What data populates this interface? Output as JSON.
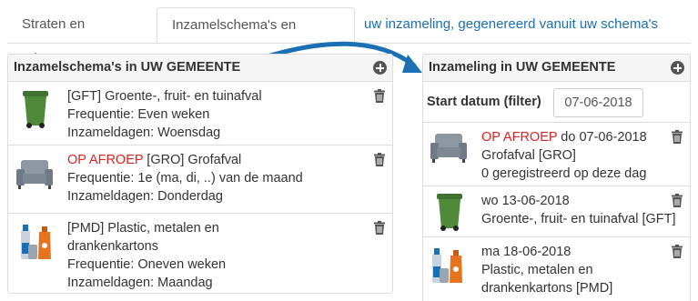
{
  "tabs": [
    {
      "label": "Straten en adressen"
    },
    {
      "label": "Inzamelschema's en datums"
    },
    {
      "label": "uw inzameling, gegenereerd vanuit uw schema's"
    }
  ],
  "left_panel": {
    "title": "Inzamelschema's in UW GEMEENTE",
    "items": [
      {
        "icon": "green-bin-icon",
        "title": "[GFT] Groente-, fruit- en tuinafval",
        "frequency": "Frequentie: Even weken",
        "days": "Inzameldagen: Woensdag"
      },
      {
        "icon": "sofa-icon",
        "badge": "OP AFROEP",
        "title": " [GRO] Grofafval",
        "frequency": "Frequentie: 1e (ma, di, ..) van de maand",
        "days": "Inzameldagen: Donderdag"
      },
      {
        "icon": "pmd-icon",
        "title": "[PMD] Plastic, metalen en",
        "title2": "drankenkartons",
        "frequency": "Frequentie: Oneven weken",
        "days": "Inzameldagen: Maandag"
      }
    ]
  },
  "right_panel": {
    "title": "Inzameling in UW GEMEENTE",
    "filter_label": "Start datum (filter)",
    "filter_value": "07-06-2018",
    "items": [
      {
        "icon": "sofa-icon",
        "badge": "OP AFROEP",
        "date": " do 07-06-2018",
        "line2": "Grofafval [GRO]",
        "line3": "0 geregistreerd op deze dag"
      },
      {
        "icon": "green-bin-icon",
        "date": "wo 13-06-2018",
        "line2": "Groente-, fruit- en tuinafval [GFT]"
      },
      {
        "icon": "pmd-icon",
        "date": "ma 18-06-2018",
        "line2": "Plastic, metalen en",
        "line3": "drankenkartons [PMD]"
      }
    ]
  },
  "colors": {
    "accent": "#1a6fb5",
    "badge": "#dd2222",
    "bin": "#4f8a3a",
    "sofa": "#7d8894"
  }
}
